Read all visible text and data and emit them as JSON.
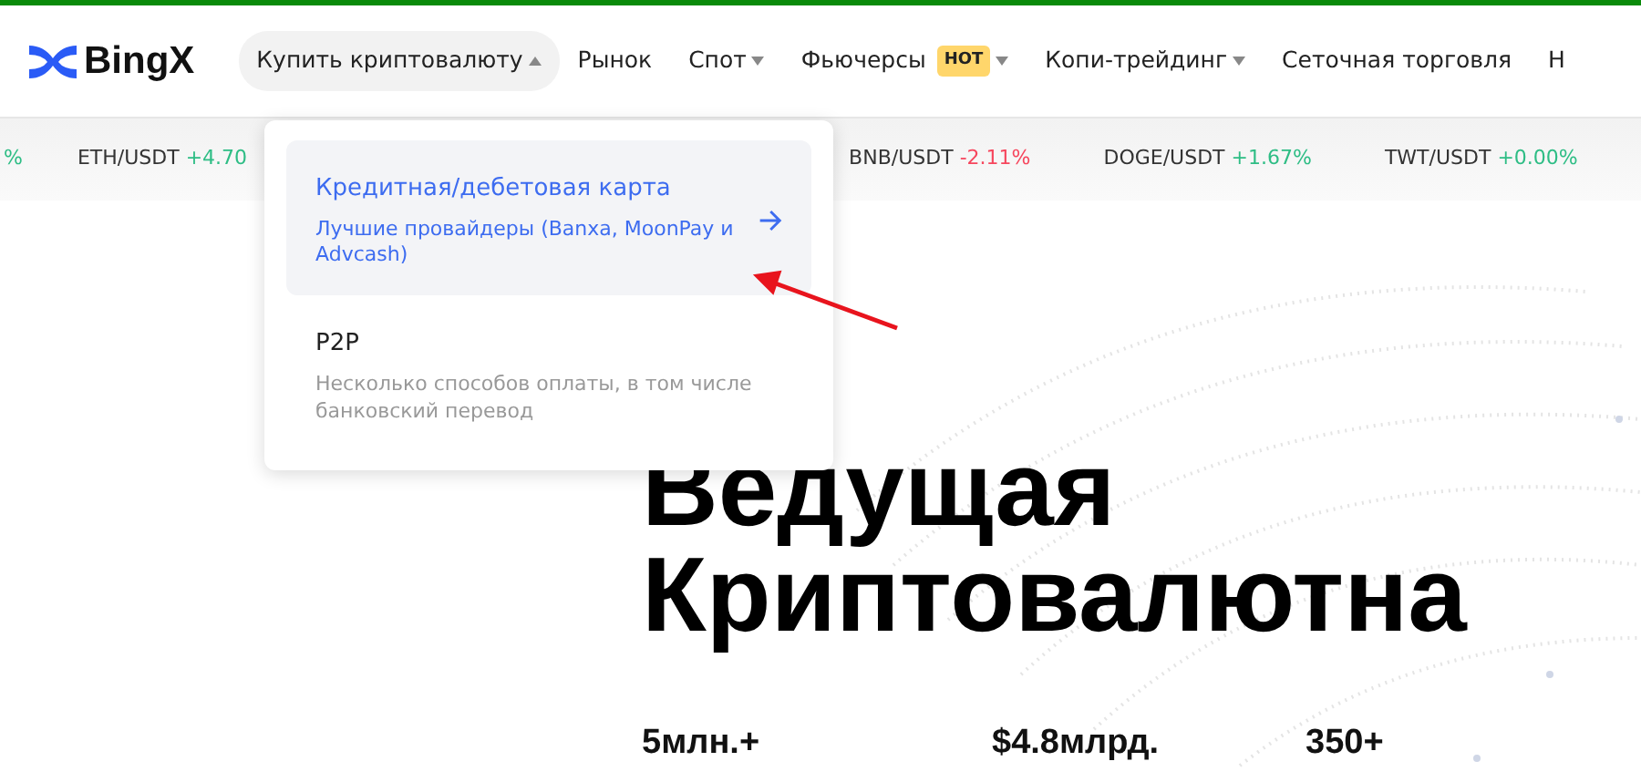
{
  "logo": {
    "text": "BingX"
  },
  "nav": [
    {
      "label": "Купить криптовалюту",
      "expanded": true,
      "has_menu": true
    },
    {
      "label": "Рынок",
      "expanded": false,
      "has_menu": false
    },
    {
      "label": "Спот",
      "expanded": false,
      "has_menu": true
    },
    {
      "label": "Фьючерсы",
      "expanded": false,
      "has_menu": true,
      "badge": "HOT"
    },
    {
      "label": "Копи-трейдинг",
      "expanded": false,
      "has_menu": true
    },
    {
      "label": "Сеточная торговля",
      "expanded": false,
      "has_menu": false
    },
    {
      "label": "Н",
      "expanded": false,
      "has_menu": false
    }
  ],
  "ticker": [
    {
      "change": "%",
      "color": "#2ebd85"
    },
    {
      "pair": "ETH/USDT",
      "change": "+4.70",
      "color": "#2ebd85"
    },
    {
      "pair": "BNB/USDT",
      "change": "-2.11%",
      "color": "#f6465d"
    },
    {
      "pair": "DOGE/USDT",
      "change": "+1.67%",
      "color": "#2ebd85"
    },
    {
      "pair": "TWT/USDT",
      "change": "+0.00%",
      "color": "#2ebd85"
    }
  ],
  "dropdown_menu": {
    "items": [
      {
        "title": "Кредитная/дебетовая карта",
        "subtitle": "Лучшие провайдеры (Banxa, MoonPay и Advcash)",
        "selected": true
      },
      {
        "title": "P2P",
        "subtitle": "Несколько способов оплаты, в том числе банковский перевод",
        "selected": false
      }
    ]
  },
  "hero": {
    "title_lines": [
      "Ведущая",
      "Криптовалютна"
    ],
    "stats": [
      "5млн.+",
      "$4.8млрд.",
      "350+"
    ]
  }
}
